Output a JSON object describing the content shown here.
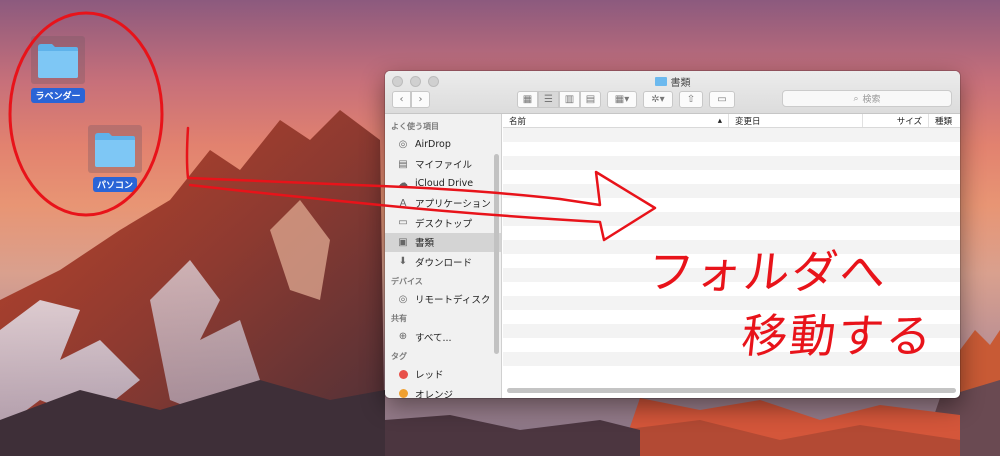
{
  "desktop": {
    "icons": [
      {
        "label": "ラベンダー"
      },
      {
        "label": "パソコン"
      }
    ]
  },
  "finder": {
    "title": "書類",
    "search_placeholder": "検索",
    "sidebar": {
      "favorites_heading": "よく使う項目",
      "favorites": [
        {
          "label": "AirDrop",
          "icon": "airdrop-icon"
        },
        {
          "label": "マイファイル",
          "icon": "files-icon"
        },
        {
          "label": "iCloud Drive",
          "icon": "cloud-icon"
        },
        {
          "label": "アプリケーション",
          "icon": "apps-icon"
        },
        {
          "label": "デスクトップ",
          "icon": "desktop-icon"
        },
        {
          "label": "書類",
          "icon": "documents-icon"
        },
        {
          "label": "ダウンロード",
          "icon": "download-icon"
        }
      ],
      "devices_heading": "デバイス",
      "devices": [
        {
          "label": "リモートディスク",
          "icon": "disc-icon"
        }
      ],
      "shared_heading": "共有",
      "shared": [
        {
          "label": "すべて...",
          "icon": "network-icon"
        }
      ],
      "tags_heading": "タグ",
      "tags": [
        {
          "label": "レッド",
          "color": "#e8504a"
        },
        {
          "label": "オレンジ",
          "color": "#f0a030"
        }
      ]
    },
    "columns": {
      "name": "名前",
      "modified": "変更日",
      "size": "サイズ",
      "kind": "種類"
    }
  },
  "annotation": {
    "line1": "フォルダへ",
    "line2": "移動する",
    "color": "#e8131a"
  }
}
